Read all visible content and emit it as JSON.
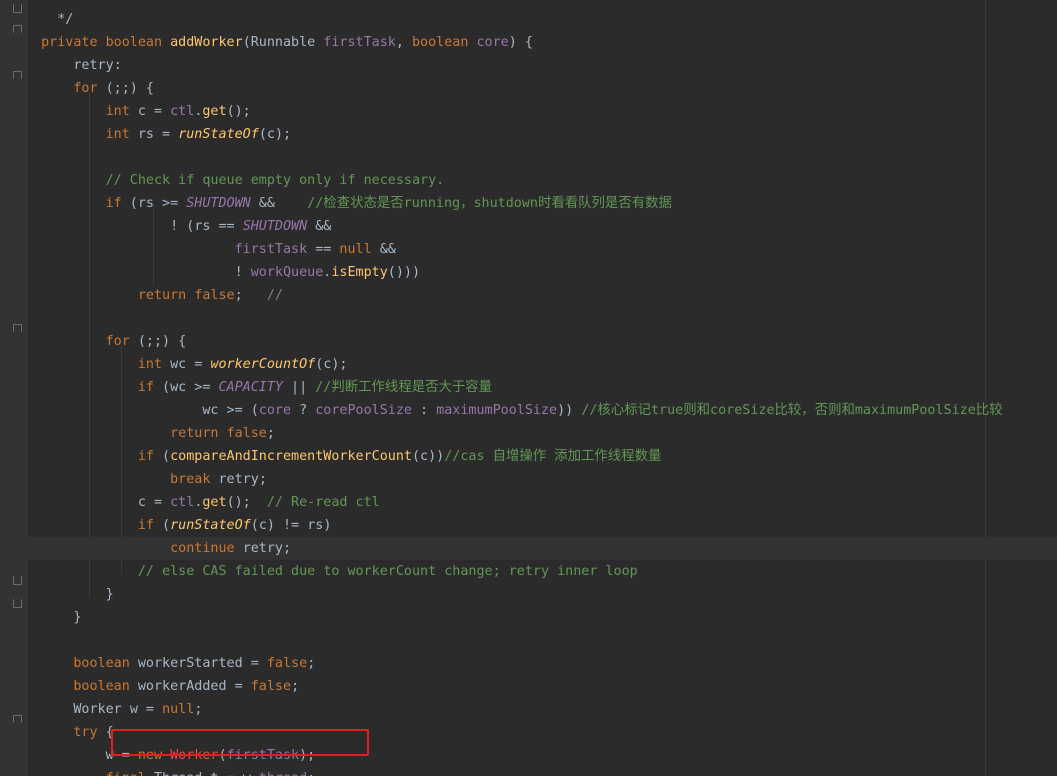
{
  "editor": {
    "language": "java",
    "highlight_color": "#e0201c",
    "lines": [
      {
        "row": 0,
        "text": "    */"
      },
      {
        "row": 1,
        "text": "  private boolean addWorker(Runnable firstTask, boolean core) {"
      },
      {
        "row": 2,
        "text": "      retry:"
      },
      {
        "row": 3,
        "text": "      for (;;) {"
      },
      {
        "row": 4,
        "text": "          int c = ctl.get();"
      },
      {
        "row": 5,
        "text": "          int rs = runStateOf(c);"
      },
      {
        "row": 6,
        "text": ""
      },
      {
        "row": 7,
        "text": "          // Check if queue empty only if necessary."
      },
      {
        "row": 8,
        "text": "          if (rs >= SHUTDOWN &&    //检查状态是否running，shutdown时看看队列是否有数据"
      },
      {
        "row": 9,
        "text": "                  ! (rs == SHUTDOWN &&"
      },
      {
        "row": 10,
        "text": "                          firstTask == null &&"
      },
      {
        "row": 11,
        "text": "                          ! workQueue.isEmpty()))"
      },
      {
        "row": 12,
        "text": "              return false;   //"
      },
      {
        "row": 13,
        "text": ""
      },
      {
        "row": 14,
        "text": "          for (;;) {"
      },
      {
        "row": 15,
        "text": "              int wc = workerCountOf(c);"
      },
      {
        "row": 16,
        "text": "              if (wc >= CAPACITY || //判断工作线程是否大于容量"
      },
      {
        "row": 17,
        "text": "                      wc >= (core ? corePoolSize : maximumPoolSize)) //核心标记true则和coreSize比较，否则和maximumPoolSize比较"
      },
      {
        "row": 18,
        "text": "                  return false;"
      },
      {
        "row": 19,
        "text": "              if (compareAndIncrementWorkerCount(c))//cas 自增操作 添加工作线程数量"
      },
      {
        "row": 20,
        "text": "                  break retry;"
      },
      {
        "row": 21,
        "text": "              c = ctl.get();  // Re-read ctl"
      },
      {
        "row": 22,
        "text": "              if (runStateOf(c) != rs)"
      },
      {
        "row": 23,
        "text": "                  continue retry;"
      },
      {
        "row": 24,
        "text": "              // else CAS failed due to workerCount change; retry inner loop"
      },
      {
        "row": 25,
        "text": "          }"
      },
      {
        "row": 26,
        "text": "      }"
      },
      {
        "row": 27,
        "text": ""
      },
      {
        "row": 28,
        "text": "      boolean workerStarted = false;"
      },
      {
        "row": 29,
        "text": "      boolean workerAdded = false;"
      },
      {
        "row": 30,
        "text": "      Worker w = null;"
      },
      {
        "row": 31,
        "text": "      try {"
      },
      {
        "row": 32,
        "text": "          w = new Worker(firstTask);"
      },
      {
        "row": 33,
        "text": "          final Thread t = w.thread;"
      }
    ]
  }
}
